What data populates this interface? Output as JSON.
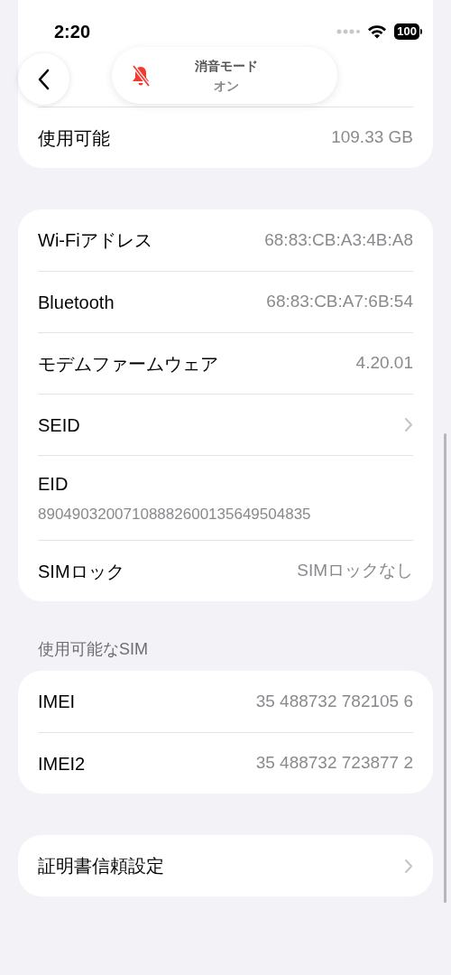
{
  "status_bar": {
    "time": "2:20",
    "battery": "100"
  },
  "back_button": {
    "kind": "back"
  },
  "banner": {
    "title": "消音モード",
    "state": "オン"
  },
  "sections": [
    {
      "rows": [
        {
          "kind": "value",
          "label": "使用可能",
          "value": "109.33 GB"
        }
      ]
    },
    {
      "rows": [
        {
          "kind": "value",
          "label": "Wi-Fiアドレス",
          "value": "68:83:CB:A3:4B:A8"
        },
        {
          "kind": "value",
          "label": "Bluetooth",
          "value": "68:83:CB:A7:6B:54"
        },
        {
          "kind": "value",
          "label": "モデムファームウェア",
          "value": "4.20.01"
        },
        {
          "kind": "chevron",
          "label": "SEID"
        },
        {
          "kind": "stacked",
          "label": "EID",
          "value": "89049032007108882600135649504835"
        },
        {
          "kind": "value",
          "label": "SIMロック",
          "value": "SIMロックなし"
        }
      ]
    },
    {
      "header": "使用可能なSIM",
      "rows": [
        {
          "kind": "value",
          "label": "IMEI",
          "value": "35 488732 782105 6"
        },
        {
          "kind": "value",
          "label": "IMEI2",
          "value": "35 488732 723877 2"
        }
      ]
    },
    {
      "rows": [
        {
          "kind": "chevron",
          "label": "証明書信頼設定"
        }
      ]
    }
  ]
}
